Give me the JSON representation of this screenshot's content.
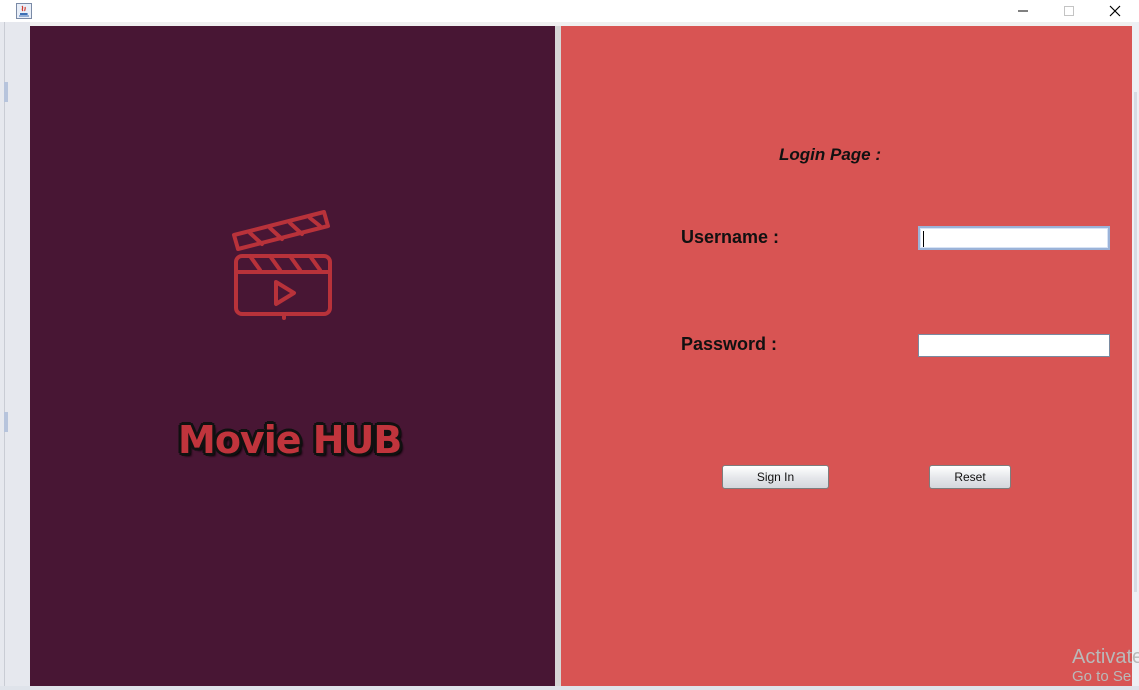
{
  "window": {
    "minimize_glyph": "—",
    "maximize_glyph": "☐",
    "close_glyph": "✕"
  },
  "brand": {
    "name": "Movie HUB",
    "logo_icon": "clapperboard-play-icon",
    "logo_color": "#b8323a"
  },
  "login": {
    "title": "Login Page :",
    "username_label": "Username :",
    "username_value": "",
    "password_label": "Password :",
    "password_value": "",
    "sign_in_label": "Sign In",
    "reset_label": "Reset"
  },
  "colors": {
    "left_panel": "#481634",
    "right_panel": "#d85453",
    "brand_text": "#c0343c"
  },
  "watermark": {
    "line1": "Activate",
    "line2": "Go to Se"
  }
}
